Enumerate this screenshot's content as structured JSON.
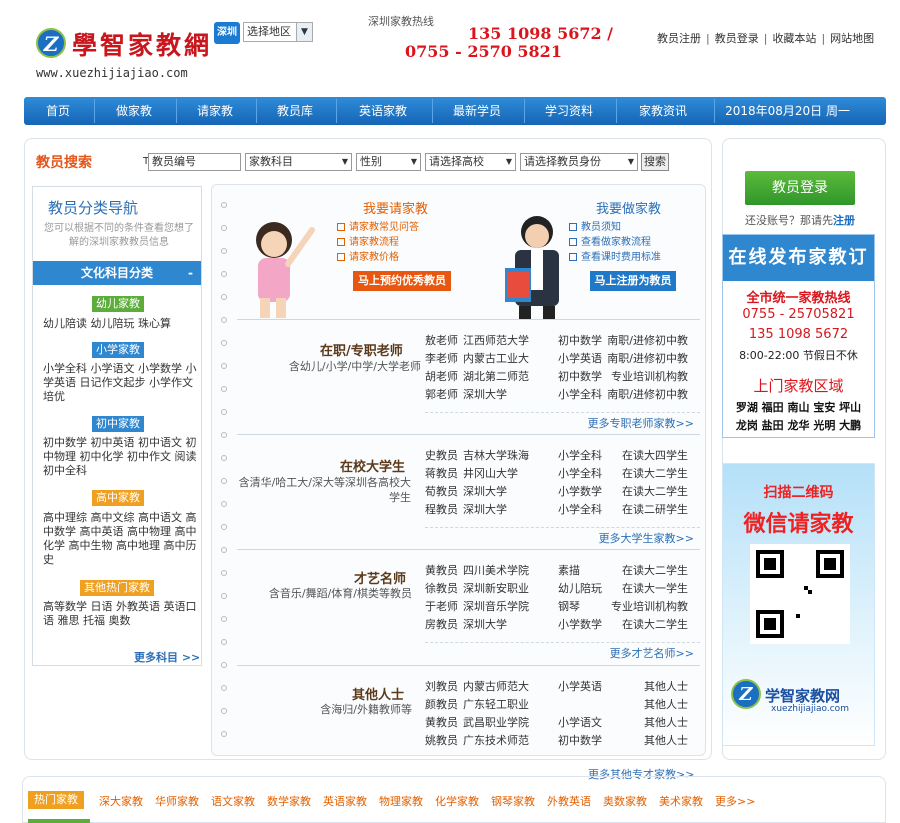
{
  "header": {
    "logo_text": "學智家教網",
    "logo_mark": "Z",
    "logo_url": "www.xuezhijiajiao.com",
    "city": "深圳",
    "region_select": "选择地区",
    "hotline_label": "深圳家教热线",
    "phone1": "135 1098 5672 /",
    "phone2": "0755 - 2570 5821",
    "links": [
      "教员注册",
      "教员登录",
      "收藏本站",
      "网站地图"
    ]
  },
  "nav": {
    "items": [
      "首页",
      "做家教",
      "请家教",
      "教员库",
      "英语家教",
      "最新学员",
      "学习资料",
      "家教资讯"
    ],
    "date": "2018年08月20日 周一"
  },
  "search": {
    "title": "教员搜索",
    "t_label": "T",
    "id_input": "教员编号",
    "subject": "家教科目",
    "gender": "性别",
    "school": "请选择高校",
    "identity": "请选择教员身份",
    "button": "搜索"
  },
  "left_nav": {
    "title": "教员分类导航",
    "desc": "您可以根据不同的条件查看您想了解的深圳家教教员信息",
    "category": "文化科目分类",
    "collapse": "-",
    "groups": [
      {
        "tag": "幼儿家教",
        "text": "幼儿陪读 幼儿陪玩 珠心算"
      },
      {
        "tag": "小学家教",
        "text": "小学全科 小学语文 小学数学 小学英语 日记作文起步 小学作文培优"
      },
      {
        "tag": "初中家教",
        "text": "初中数学 初中英语 初中语文 初中物理 初中化学 初中作文 阅读 初中全科"
      },
      {
        "tag": "高中家教",
        "text": "高中理综 高中文综 高中语文 高中数学 高中英语 高中物理 高中化学 高中生物 高中地理 高中历史"
      },
      {
        "tag": "其他热门家教",
        "text": "高等数学 日语 外教英语 英语口语 雅思 托福 奥数"
      }
    ],
    "more": "更多科目 >>"
  },
  "promo": {
    "left_title": "我要请家教",
    "left_items": [
      "请家教常见问答",
      "请家教流程",
      "请家教价格"
    ],
    "left_button": "马上预约优秀教员",
    "right_title": "我要做家教",
    "right_items": [
      "教员须知",
      "查看做家教流程",
      "查看课时费用标准"
    ],
    "right_button": "马上注册为教员"
  },
  "sections": [
    {
      "title": "在职/专职老师",
      "sub": "含幼儿/小学/中学/大学老师",
      "more": "更多专职老师家教>>",
      "rows": [
        [
          "敖老师",
          "江西师范大学",
          "初中数学",
          "南职/进修初中教"
        ],
        [
          "李老师",
          "内蒙古工业大",
          "小学英语",
          "南职/进修初中教"
        ],
        [
          "胡老师",
          "湖北第二师范",
          "初中数学",
          "专业培训机构教"
        ],
        [
          "郭老师",
          "深圳大学",
          "小学全科",
          "南职/进修初中教"
        ]
      ]
    },
    {
      "title": "在校大学生",
      "sub": "含清华/哈工大/深大等深圳各高校大学生",
      "more": "更多大学生家教>>",
      "rows": [
        [
          "史教员",
          "吉林大学珠海",
          "小学全科",
          "在读大四学生"
        ],
        [
          "蒋教员",
          "井冈山大学",
          "小学全科",
          "在读大二学生"
        ],
        [
          "荀教员",
          "深圳大学",
          "小学数学",
          "在读大二学生"
        ],
        [
          "程教员",
          "深圳大学",
          "小学全科",
          "在读二研学生"
        ]
      ]
    },
    {
      "title": "才艺名师",
      "sub": "含音乐/舞蹈/体育/棋类等教员",
      "more": "更多才艺名师>>",
      "rows": [
        [
          "黄教员",
          "四川美术学院",
          "素描",
          "在读大二学生"
        ],
        [
          "徐教员",
          "深圳新安职业",
          "幼儿陪玩",
          "在读大一学生"
        ],
        [
          "于老师",
          "深圳音乐学院",
          "钢琴",
          "专业培训机构教"
        ],
        [
          "房教员",
          "深圳大学",
          "小学数学",
          "在读大二学生"
        ]
      ]
    },
    {
      "title": "其他人士",
      "sub": "含海归/外籍教师等",
      "more": "更多其他专才家教>>",
      "rows": [
        [
          "刘教员",
          "内蒙古师范大",
          "小学英语",
          "其他人士"
        ],
        [
          "颜教员",
          "广东轻工职业",
          "",
          "其他人士"
        ],
        [
          "黄教员",
          "武昌职业学院",
          "小学语文",
          "其他人士"
        ],
        [
          "姚教员",
          "广东技术师范",
          "初中数学",
          "其他人士"
        ]
      ]
    }
  ],
  "right": {
    "login": "教员登录",
    "reg_text": "还没账号？那请先",
    "reg_link": "注册",
    "order_title": "在线发布家教订单",
    "hotline_title": "全市统一家教热线",
    "tel1": "0755 - 25705821",
    "tel2": "135 1098 5672",
    "hours": "8:00-22:00 节假日不休",
    "area_title": "上门家教区域",
    "areas1": "罗湖 福田 南山 宝安 坪山",
    "areas2": "龙岗 盐田 龙华 光明 大鹏",
    "qr_t1": "扫描二维码",
    "qr_t2": "微信请家教",
    "qr_logo_name": "学智家教网",
    "qr_logo_url": "xuezhijiajiao.com"
  },
  "footer": {
    "hot": "热门家教",
    "keywords": [
      "深大家教",
      "华师家教",
      "语文家教",
      "数学家教",
      "英语家教",
      "物理家教",
      "化学家教",
      "钢琴家教",
      "外教英语",
      "奥数家教",
      "美术家教",
      "更多>>"
    ]
  },
  "colors": {
    "accent": "#2f87d0",
    "brand_red": "#d9161d",
    "orange": "#e26000",
    "green": "#5cad3c"
  }
}
